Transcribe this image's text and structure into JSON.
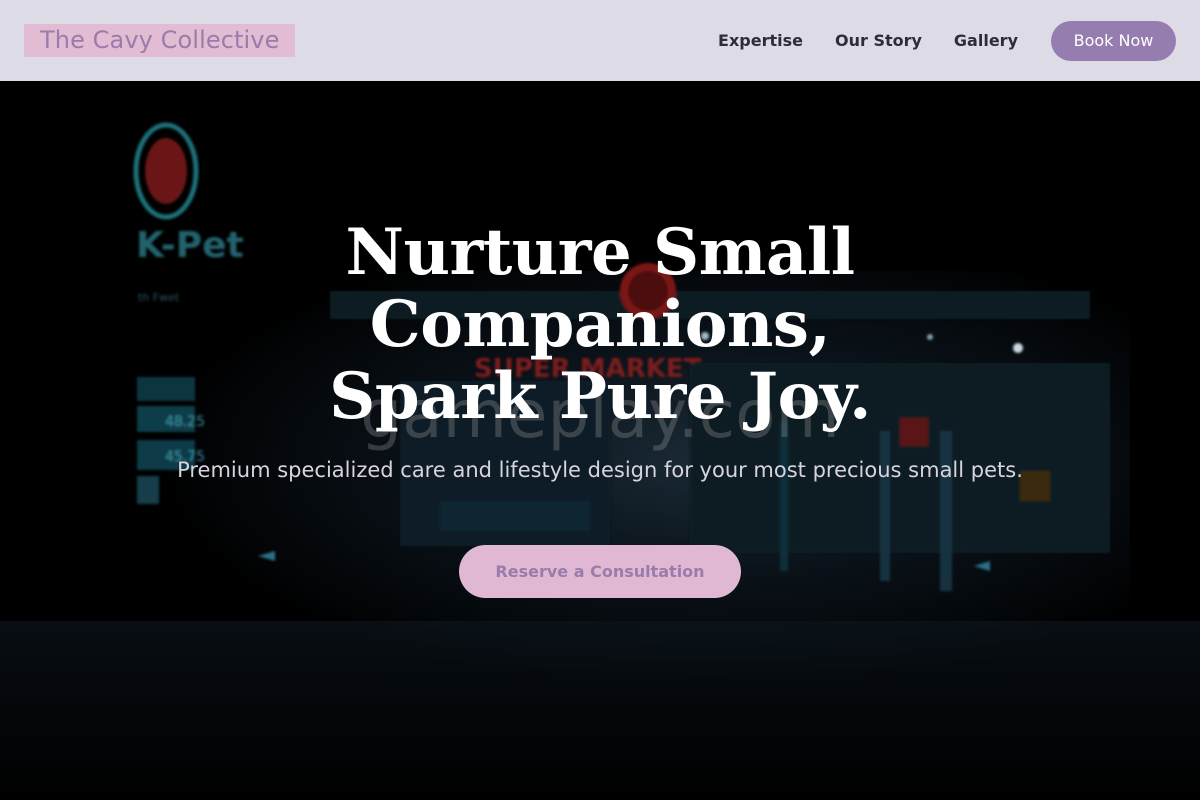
{
  "header": {
    "logo": "The Cavy Collective",
    "nav": [
      {
        "label": "Expertise"
      },
      {
        "label": "Our Story"
      },
      {
        "label": "Gallery"
      }
    ],
    "book_label": "Book Now"
  },
  "hero": {
    "headline_lines": [
      "Nurture Small",
      "Companions,",
      "Spark Pure Joy."
    ],
    "subtitle": "Premium specialized care and lifestyle design for your most precious small pets.",
    "cta_label": "Reserve a Consultation",
    "background": {
      "store_sign": "K-Pet",
      "street_text": "th Fwet",
      "banner_text": "SUPER MARKET",
      "price_1": "48.25",
      "price_2": "45.75",
      "watermark": "gameplay.com"
    }
  },
  "colors": {
    "header_bg": "#dddbe6",
    "logo_bg": "#e2bcd3",
    "logo_text": "#9a7cab",
    "book_button": "#967daf",
    "cta_bg": "#e1b8d3",
    "cta_text": "#9a7cab"
  }
}
